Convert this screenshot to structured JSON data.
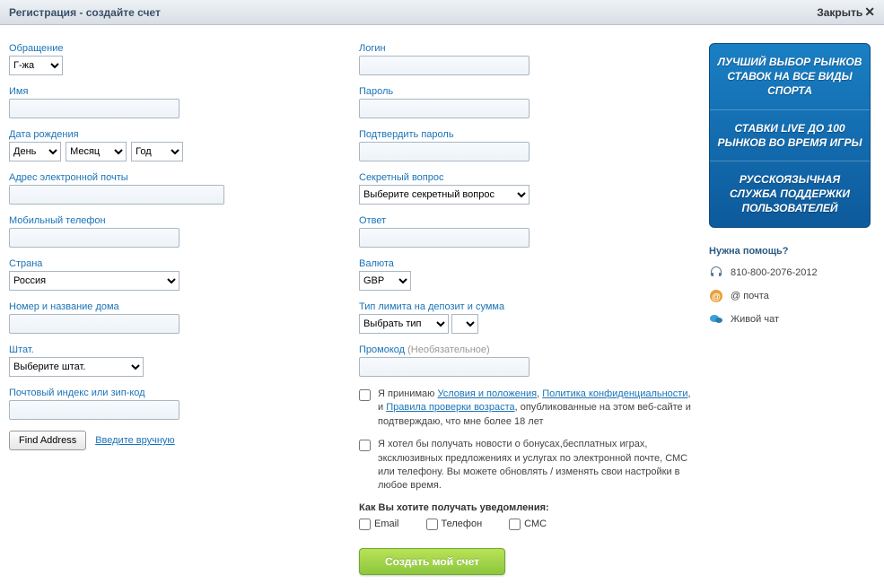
{
  "titlebar": {
    "title": "Регистрация - создайте счет",
    "close": "Закрыть"
  },
  "left": {
    "salutation_label": "Обращение",
    "salutation_value": "Г-жа",
    "name_label": "Имя",
    "dob_label": "Дата рождения",
    "dob_day": "День",
    "dob_month": "Месяц",
    "dob_year": "Год",
    "email_label": "Адрес электронной почты",
    "mobile_label": "Мобильный телефон",
    "country_label": "Страна",
    "country_value": "Россия",
    "house_label": "Номер и название дома",
    "state_label": "Штат.",
    "state_value": "Выберите штат.",
    "postcode_label": "Почтовый индекс или зип-код",
    "find_address": "Find Address",
    "manual_entry": "Введите вручную"
  },
  "right": {
    "login_label": "Логин",
    "password_label": "Пароль",
    "confirm_label": "Подтвердить пароль",
    "secret_q_label": "Секретный вопрос",
    "secret_q_value": "Выберите секретный вопрос",
    "answer_label": "Ответ",
    "currency_label": "Валюта",
    "currency_value": "GBP",
    "limit_label": "Тип лимита на депозит и сумма",
    "limit_value": "Выбрать тип",
    "promo_label": "Промокод",
    "promo_optional": "(Необязательное)",
    "terms_prefix": "Я принимаю ",
    "terms1": "Условия и положения",
    "terms_sep1": ", ",
    "terms2": "Политика конфиденциальности",
    "terms_sep2": ", и ",
    "terms3": "Правила проверки возраста",
    "terms_suffix": ", опубликованные на этом веб-сайте и подтверждаю, что мне более 18 лет",
    "news_text": "Я хотел бы получать новости о бонусах,бесплатных играх, эксклюзивных предложениях и услугах по электронной почте, СМС или телефону. Вы можете обновлять / изменять свои настройки в любое время.",
    "notif_label": "Как Вы хотите получать уведомления:",
    "notif_email": "Email",
    "notif_phone": "Телефон",
    "notif_sms": "СМС",
    "submit": "Создать мой счет"
  },
  "sidebar": {
    "promo1": "ЛУЧШИЙ ВЫБОР РЫНКОВ СТАВОК НА ВСЕ ВИДЫ СПОРТА",
    "promo2": "СТАВКИ LIVE ДО 100 РЫНКОВ ВО ВРЕМЯ ИГРЫ",
    "promo3": "РУССКОЯЗЫЧНАЯ СЛУЖБА ПОДДЕРЖКИ ПОЛЬЗОВАТЕЛЕЙ",
    "help_title": "Нужна помощь?",
    "phone": "810-800-2076-2012",
    "email": "@ почта",
    "chat": "Живой чат"
  }
}
